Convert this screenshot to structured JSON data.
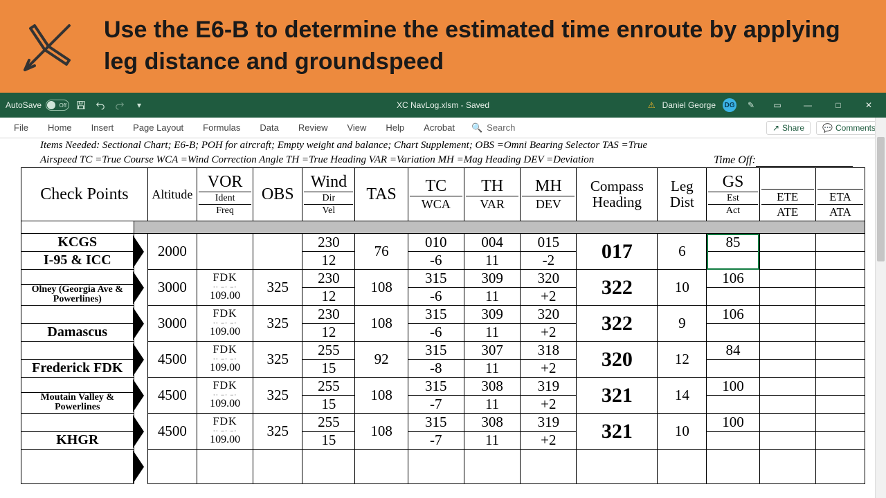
{
  "banner": {
    "text": "Use the E6-B to determine the estimated time enroute by applying leg distance and groundspeed"
  },
  "titlebar": {
    "autosave": "AutoSave",
    "autosave_state": "Off",
    "doc": "XC NavLog.xlsm - Saved",
    "user": "Daniel George",
    "user_initials": "DG"
  },
  "ribbon": {
    "tabs": [
      "File",
      "Home",
      "Insert",
      "Page Layout",
      "Formulas",
      "Data",
      "Review",
      "View",
      "Help",
      "Acrobat"
    ],
    "search_placeholder": "Search",
    "share": "Share",
    "comments": "Comments"
  },
  "notes": {
    "line1": "Items Needed: Sectional Chart; E6-B; POH for aircraft; Empty weight and balance; Chart Supplement;  OBS =Omni Bearing Selector  TAS =True",
    "line2": "Airspeed  TC =True Course  WCA =Wind Correction Angle  TH =True Heading  VAR =Variation  MH =Mag Heading  DEV =Deviation",
    "timeoff": "Time Off:"
  },
  "headers": {
    "cp": "Check Points",
    "alt": "Altitude",
    "vor": "VOR",
    "vor_s1": "Ident",
    "vor_s2": "Freq",
    "obs": "OBS",
    "wind": "Wind",
    "wind_s1": "Dir",
    "wind_s2": "Vel",
    "tas": "TAS",
    "tc": "TC",
    "tc_s": "WCA",
    "th": "TH",
    "th_s": "VAR",
    "mh": "MH",
    "mh_s": "DEV",
    "ch": "Compass Heading",
    "ld": "Leg Dist",
    "gs": "GS",
    "gs_s1": "Est",
    "gs_s2": "Act",
    "ete": "ETE",
    "ate": "ATE",
    "eta": "ETA",
    "ata": "ATA"
  },
  "checkpoints": [
    "KCGS",
    "I-95 & ICC",
    "Olney (Georgia Ave & Powerlines)",
    "Damascus",
    "Frederick FDK",
    "Moutain Valley & Powerlines",
    "KHGR"
  ],
  "legs": [
    {
      "alt": "2000",
      "vor_id": "",
      "vor_fr": "",
      "obs": "",
      "wind_d": "230",
      "wind_v": "12",
      "tas": "76",
      "tc": "010",
      "wca": "-6",
      "th": "004",
      "var": "11",
      "mh": "015",
      "dev": "-2",
      "ch": "017",
      "ld": "6",
      "gs": "85",
      "ete": "",
      "eta": ""
    },
    {
      "alt": "3000",
      "vor_id": "FDK",
      "vor_fr": "109.00",
      "obs": "325",
      "wind_d": "230",
      "wind_v": "12",
      "tas": "108",
      "tc": "315",
      "wca": "-6",
      "th": "309",
      "var": "11",
      "mh": "320",
      "dev": "+2",
      "ch": "322",
      "ld": "10",
      "gs": "106",
      "ete": "",
      "eta": ""
    },
    {
      "alt": "3000",
      "vor_id": "FDK",
      "vor_fr": "109.00",
      "obs": "325",
      "wind_d": "230",
      "wind_v": "12",
      "tas": "108",
      "tc": "315",
      "wca": "-6",
      "th": "309",
      "var": "11",
      "mh": "320",
      "dev": "+2",
      "ch": "322",
      "ld": "9",
      "gs": "106",
      "ete": "",
      "eta": ""
    },
    {
      "alt": "4500",
      "vor_id": "FDK",
      "vor_fr": "109.00",
      "obs": "325",
      "wind_d": "255",
      "wind_v": "15",
      "tas": "92",
      "tc": "315",
      "wca": "-8",
      "th": "307",
      "var": "11",
      "mh": "318",
      "dev": "+2",
      "ch": "320",
      "ld": "12",
      "gs": "84",
      "ete": "",
      "eta": ""
    },
    {
      "alt": "4500",
      "vor_id": "FDK",
      "vor_fr": "109.00",
      "obs": "325",
      "wind_d": "255",
      "wind_v": "15",
      "tas": "108",
      "tc": "315",
      "wca": "-7",
      "th": "308",
      "var": "11",
      "mh": "319",
      "dev": "+2",
      "ch": "321",
      "ld": "14",
      "gs": "100",
      "ete": "",
      "eta": ""
    },
    {
      "alt": "4500",
      "vor_id": "FDK",
      "vor_fr": "109.00",
      "obs": "325",
      "wind_d": "255",
      "wind_v": "15",
      "tas": "108",
      "tc": "315",
      "wca": "-7",
      "th": "308",
      "var": "11",
      "mh": "319",
      "dev": "+2",
      "ch": "321",
      "ld": "10",
      "gs": "100",
      "ete": "",
      "eta": ""
    }
  ]
}
